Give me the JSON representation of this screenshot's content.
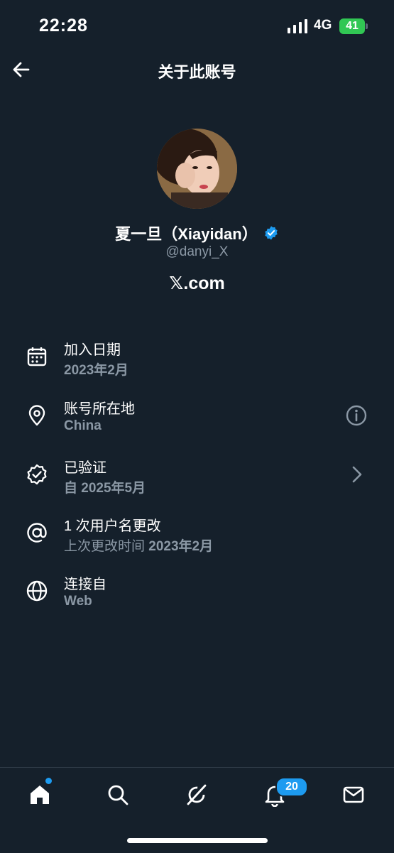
{
  "status": {
    "time": "22:28",
    "network": "4G",
    "battery": "41"
  },
  "header": {
    "title": "关于此账号"
  },
  "profile": {
    "display_name": "夏一旦（Xiayidan）",
    "handle": "@danyi_X",
    "site": "𝕏.com"
  },
  "info": {
    "joined": {
      "title": "加入日期",
      "value": "2023年2月"
    },
    "location": {
      "title": "账号所在地",
      "value": "China"
    },
    "verified": {
      "title": "已验证",
      "value": "自 2025年5月"
    },
    "username_changes": {
      "title": "1 次用户名更改",
      "value_prefix": "上次更改时间 ",
      "value": "2023年2月"
    },
    "connected": {
      "title": "连接自",
      "value": "Web"
    }
  },
  "tabbar": {
    "notifications_badge": "20"
  },
  "colors": {
    "background": "#15202b",
    "accent": "#1d9bf0",
    "secondary_text": "#8b98a5"
  },
  "icons": [
    "back-arrow-icon",
    "calendar-icon",
    "location-pin-icon",
    "verified-badge-icon",
    "at-sign-icon",
    "globe-icon",
    "info-icon",
    "chevron-right-icon",
    "home-icon",
    "search-icon",
    "grok-icon",
    "bell-icon",
    "mail-icon"
  ]
}
